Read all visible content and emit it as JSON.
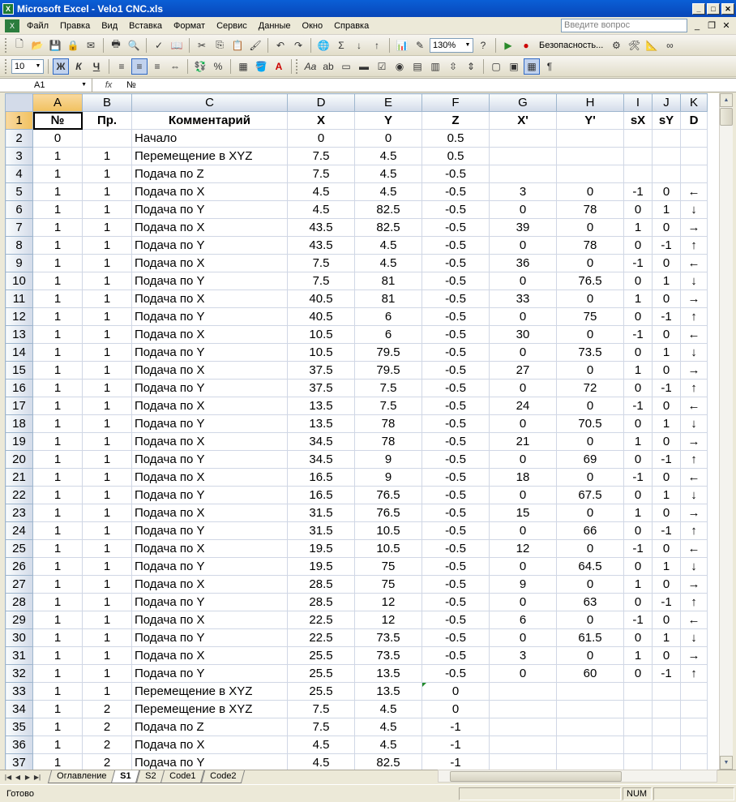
{
  "window": {
    "title": "Microsoft Excel - Velo1 CNC.xls"
  },
  "menu": {
    "items": [
      "Файл",
      "Правка",
      "Вид",
      "Вставка",
      "Формат",
      "Сервис",
      "Данные",
      "Окно",
      "Справка"
    ],
    "help_placeholder": "Введите вопрос"
  },
  "toolbar1": {
    "zoom": "130%",
    "security": "Безопасность..."
  },
  "toolbar2": {
    "font_size": "10",
    "bold": "Ж",
    "italic": "К",
    "underline": "Ч",
    "percent": "%"
  },
  "formula_bar": {
    "name_box": "A1",
    "fx": "fx",
    "content": "№"
  },
  "sheet": {
    "columns": [
      "A",
      "B",
      "C",
      "D",
      "E",
      "F",
      "G",
      "H",
      "I",
      "J",
      "K"
    ],
    "header": [
      "№",
      "Пр.",
      "Комментарий",
      "X",
      "Y",
      "Z",
      "X'",
      "Y'",
      "sX",
      "sY",
      "D"
    ],
    "rows": [
      [
        "0",
        "",
        "Начало",
        "0",
        "0",
        "0.5",
        "",
        "",
        "",
        "",
        ""
      ],
      [
        "1",
        "1",
        "Перемещение в XYZ",
        "7.5",
        "4.5",
        "0.5",
        "",
        "",
        "",
        "",
        ""
      ],
      [
        "1",
        "1",
        "Подача по Z",
        "7.5",
        "4.5",
        "-0.5",
        "",
        "",
        "",
        "",
        ""
      ],
      [
        "1",
        "1",
        "Подача по X",
        "4.5",
        "4.5",
        "-0.5",
        "3",
        "0",
        "-1",
        "0",
        "←"
      ],
      [
        "1",
        "1",
        "Подача по Y",
        "4.5",
        "82.5",
        "-0.5",
        "0",
        "78",
        "0",
        "1",
        "↓"
      ],
      [
        "1",
        "1",
        "Подача по X",
        "43.5",
        "82.5",
        "-0.5",
        "39",
        "0",
        "1",
        "0",
        "→"
      ],
      [
        "1",
        "1",
        "Подача по Y",
        "43.5",
        "4.5",
        "-0.5",
        "0",
        "78",
        "0",
        "-1",
        "↑"
      ],
      [
        "1",
        "1",
        "Подача по X",
        "7.5",
        "4.5",
        "-0.5",
        "36",
        "0",
        "-1",
        "0",
        "←"
      ],
      [
        "1",
        "1",
        "Подача по Y",
        "7.5",
        "81",
        "-0.5",
        "0",
        "76.5",
        "0",
        "1",
        "↓"
      ],
      [
        "1",
        "1",
        "Подача по X",
        "40.5",
        "81",
        "-0.5",
        "33",
        "0",
        "1",
        "0",
        "→"
      ],
      [
        "1",
        "1",
        "Подача по Y",
        "40.5",
        "6",
        "-0.5",
        "0",
        "75",
        "0",
        "-1",
        "↑"
      ],
      [
        "1",
        "1",
        "Подача по X",
        "10.5",
        "6",
        "-0.5",
        "30",
        "0",
        "-1",
        "0",
        "←"
      ],
      [
        "1",
        "1",
        "Подача по Y",
        "10.5",
        "79.5",
        "-0.5",
        "0",
        "73.5",
        "0",
        "1",
        "↓"
      ],
      [
        "1",
        "1",
        "Подача по X",
        "37.5",
        "79.5",
        "-0.5",
        "27",
        "0",
        "1",
        "0",
        "→"
      ],
      [
        "1",
        "1",
        "Подача по Y",
        "37.5",
        "7.5",
        "-0.5",
        "0",
        "72",
        "0",
        "-1",
        "↑"
      ],
      [
        "1",
        "1",
        "Подача по X",
        "13.5",
        "7.5",
        "-0.5",
        "24",
        "0",
        "-1",
        "0",
        "←"
      ],
      [
        "1",
        "1",
        "Подача по Y",
        "13.5",
        "78",
        "-0.5",
        "0",
        "70.5",
        "0",
        "1",
        "↓"
      ],
      [
        "1",
        "1",
        "Подача по X",
        "34.5",
        "78",
        "-0.5",
        "21",
        "0",
        "1",
        "0",
        "→"
      ],
      [
        "1",
        "1",
        "Подача по Y",
        "34.5",
        "9",
        "-0.5",
        "0",
        "69",
        "0",
        "-1",
        "↑"
      ],
      [
        "1",
        "1",
        "Подача по X",
        "16.5",
        "9",
        "-0.5",
        "18",
        "0",
        "-1",
        "0",
        "←"
      ],
      [
        "1",
        "1",
        "Подача по Y",
        "16.5",
        "76.5",
        "-0.5",
        "0",
        "67.5",
        "0",
        "1",
        "↓"
      ],
      [
        "1",
        "1",
        "Подача по X",
        "31.5",
        "76.5",
        "-0.5",
        "15",
        "0",
        "1",
        "0",
        "→"
      ],
      [
        "1",
        "1",
        "Подача по Y",
        "31.5",
        "10.5",
        "-0.5",
        "0",
        "66",
        "0",
        "-1",
        "↑"
      ],
      [
        "1",
        "1",
        "Подача по X",
        "19.5",
        "10.5",
        "-0.5",
        "12",
        "0",
        "-1",
        "0",
        "←"
      ],
      [
        "1",
        "1",
        "Подача по Y",
        "19.5",
        "75",
        "-0.5",
        "0",
        "64.5",
        "0",
        "1",
        "↓"
      ],
      [
        "1",
        "1",
        "Подача по X",
        "28.5",
        "75",
        "-0.5",
        "9",
        "0",
        "1",
        "0",
        "→"
      ],
      [
        "1",
        "1",
        "Подача по Y",
        "28.5",
        "12",
        "-0.5",
        "0",
        "63",
        "0",
        "-1",
        "↑"
      ],
      [
        "1",
        "1",
        "Подача по X",
        "22.5",
        "12",
        "-0.5",
        "6",
        "0",
        "-1",
        "0",
        "←"
      ],
      [
        "1",
        "1",
        "Подача по Y",
        "22.5",
        "73.5",
        "-0.5",
        "0",
        "61.5",
        "0",
        "1",
        "↓"
      ],
      [
        "1",
        "1",
        "Подача по X",
        "25.5",
        "73.5",
        "-0.5",
        "3",
        "0",
        "1",
        "0",
        "→"
      ],
      [
        "1",
        "1",
        "Подача по Y",
        "25.5",
        "13.5",
        "-0.5",
        "0",
        "60",
        "0",
        "-1",
        "↑"
      ],
      [
        "1",
        "1",
        "Перемещение в XYZ",
        "25.5",
        "13.5",
        "0",
        "",
        "",
        "",
        "",
        ""
      ],
      [
        "1",
        "2",
        "Перемещение в XYZ",
        "7.5",
        "4.5",
        "0",
        "",
        "",
        "",
        "",
        ""
      ],
      [
        "1",
        "2",
        "Подача по Z",
        "7.5",
        "4.5",
        "-1",
        "",
        "",
        "",
        "",
        ""
      ],
      [
        "1",
        "2",
        "Подача по X",
        "4.5",
        "4.5",
        "-1",
        "",
        "",
        "",
        "",
        ""
      ],
      [
        "1",
        "2",
        "Подача по Y",
        "4.5",
        "82.5",
        "-1",
        "",
        "",
        "",
        "",
        ""
      ]
    ]
  },
  "sheet_tabs": [
    "Оглавление",
    "S1",
    "S2",
    "Code1",
    "Code2"
  ],
  "active_tab": "S1",
  "status": {
    "text": "Готово",
    "num": "NUM"
  }
}
